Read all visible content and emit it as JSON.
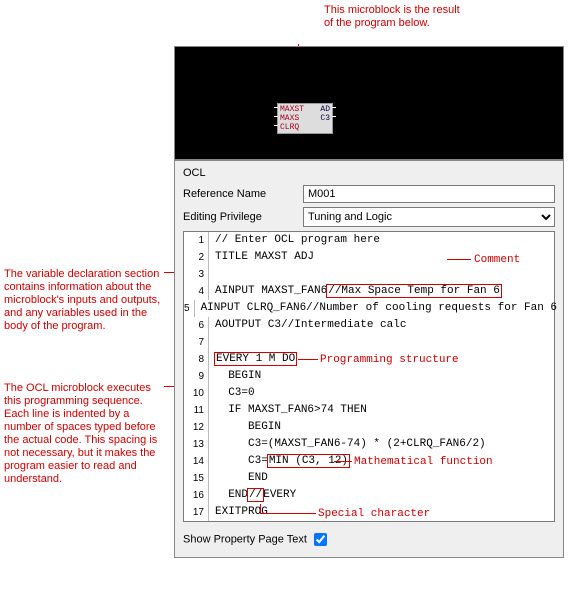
{
  "top_caption": "This microblock is the result of the program below.",
  "microblock": {
    "rows": [
      {
        "l": "MAXST",
        "r": "AD"
      },
      {
        "l": "MAXS",
        "r": "C3"
      },
      {
        "l": "CLRQ",
        "r": ""
      }
    ]
  },
  "panel": {
    "title": "OCL",
    "ref_label": "Reference Name",
    "ref_value": "M001",
    "priv_label": "Editing Privilege",
    "priv_value": "Tuning and Logic",
    "show_text_label": "Show Property Page Text"
  },
  "code": [
    "// Enter OCL program here",
    "TITLE MAXST ADJ",
    "",
    "AINPUT MAXST_FAN6//Max Space Temp for Fan 6",
    "AINPUT CLRQ_FAN6//Number of cooling requests for Fan 6",
    "AOUTPUT C3//Intermediate calc",
    "",
    "EVERY 1 M DO",
    "  BEGIN",
    "  C3=0",
    "  IF MAXST_FAN6>74 THEN",
    "     BEGIN",
    "     C3=(MAXST_FAN6-74) * (2+CLRQ_FAN6/2)",
    "     C3=MIN (C3, 12)",
    "     END",
    "  END//EVERY",
    "EXITPROG"
  ],
  "boxes": {
    "l4": {
      "pre": "AINPUT MAXST_FAN6",
      "box": "//Max Space Temp for Fan 6",
      "post": ""
    },
    "l8": {
      "pre": "",
      "box": "EVERY 1 M DO",
      "post": ""
    },
    "l14": {
      "pre": "     C3=",
      "box": "MIN (C3, 12)",
      "post": ""
    },
    "l16": {
      "pre": "  END",
      "box": "//",
      "post": "EVERY"
    }
  },
  "side1": "The variable declaration section contains information about the microblock's inputs and outputs, and any variables used in the body of the program.",
  "side2": "The OCL microblock executes this programming sequence. Each line is indented by a number of spaces typed before the actual code. This spacing is not necessary, but it makes the program easier to read and understand.",
  "callouts": {
    "comment": "Comment",
    "prog_struct": "Programming structure",
    "math_fn": "Mathematical function",
    "special": "Special character"
  }
}
